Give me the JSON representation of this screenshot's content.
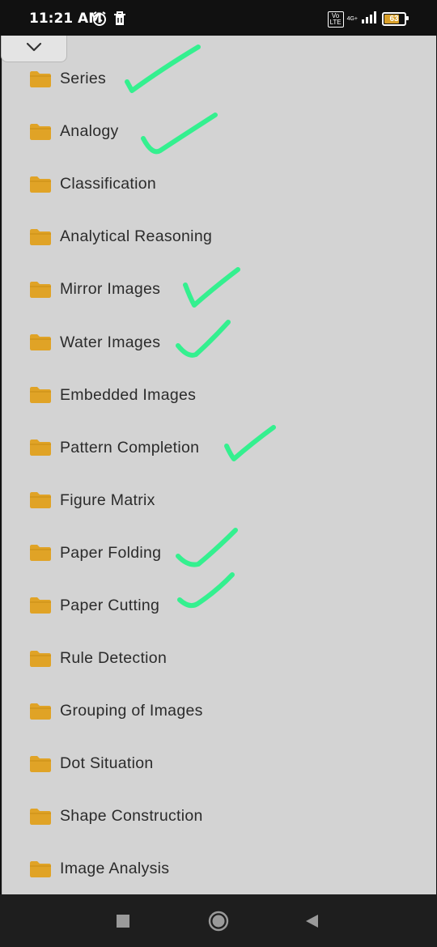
{
  "status_bar": {
    "time": "11:21 AM",
    "volte": "Vo LTE",
    "network": "4G+",
    "battery": "63",
    "icons": [
      "alarm-icon",
      "trash-icon",
      "signal-icon",
      "battery-icon"
    ]
  },
  "header": {
    "collapse_icon": "chevron-down-icon"
  },
  "folders": [
    {
      "label": "Series"
    },
    {
      "label": "Analogy"
    },
    {
      "label": "Classification"
    },
    {
      "label": "Analytical Reasoning"
    },
    {
      "label": "Mirror Images"
    },
    {
      "label": "Water Images"
    },
    {
      "label": "Embedded Images"
    },
    {
      "label": "Pattern Completion"
    },
    {
      "label": "Figure Matrix"
    },
    {
      "label": "Paper Folding"
    },
    {
      "label": "Paper Cutting"
    },
    {
      "label": "Rule Detection"
    },
    {
      "label": "Grouping of Images"
    },
    {
      "label": "Dot Situation"
    },
    {
      "label": "Shape Construction"
    },
    {
      "label": "Image Analysis"
    }
  ],
  "checked_folders": [
    "Series",
    "Analogy",
    "Mirror Images",
    "Water Images",
    "Pattern Completion",
    "Paper Folding",
    "Paper Cutting"
  ],
  "colors": {
    "folder": "#e0a326",
    "checkmark": "#34f08f",
    "background": "#d3d3d3"
  },
  "nav_bar": {
    "icons": [
      "recents-square-icon",
      "home-circle-icon",
      "back-triangle-icon"
    ]
  }
}
